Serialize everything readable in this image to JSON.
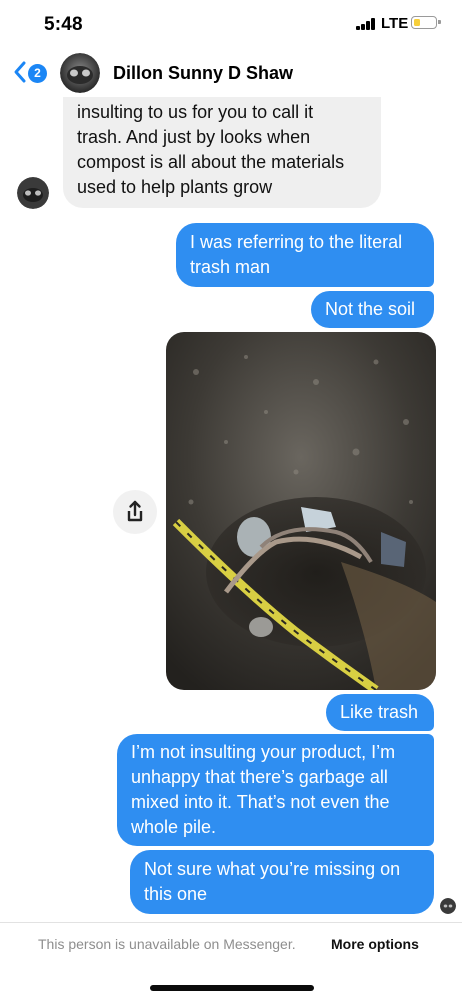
{
  "status_bar": {
    "time": "5:48",
    "network": "LTE"
  },
  "header": {
    "unread_count": "2",
    "contact_name": "Dillon Sunny D Shaw"
  },
  "messages": [
    {
      "direction": "incoming",
      "lines": [
        "insulting to us for you to call it",
        "trash. And just by looks when",
        "compost is all about the materials",
        "used to help plants grow"
      ]
    },
    {
      "direction": "outgoing",
      "lines": [
        "I was referring to the literal",
        "trash man"
      ]
    },
    {
      "direction": "outgoing",
      "lines": [
        "Not the soil"
      ]
    },
    {
      "direction": "outgoing",
      "type": "photo",
      "description": "compost pile with trash mixed in"
    },
    {
      "direction": "outgoing",
      "lines": [
        "Like trash"
      ]
    },
    {
      "direction": "outgoing",
      "lines": [
        "I’m not insulting your product, I’m",
        "unhappy that there’s garbage all",
        "mixed into it. That’s not even the",
        "whole pile."
      ]
    },
    {
      "direction": "outgoing",
      "lines": [
        "Not sure what you’re missing on",
        "this one"
      ]
    }
  ],
  "footer": {
    "note": "This person is unavailable on Messenger.",
    "link": "More options"
  },
  "colors": {
    "outgoing_bubble": "#2f8ef1",
    "incoming_bubble": "#efefef",
    "accent": "#1b86f5"
  },
  "icons": {
    "back": "chevron-left-icon",
    "share": "share-icon"
  }
}
